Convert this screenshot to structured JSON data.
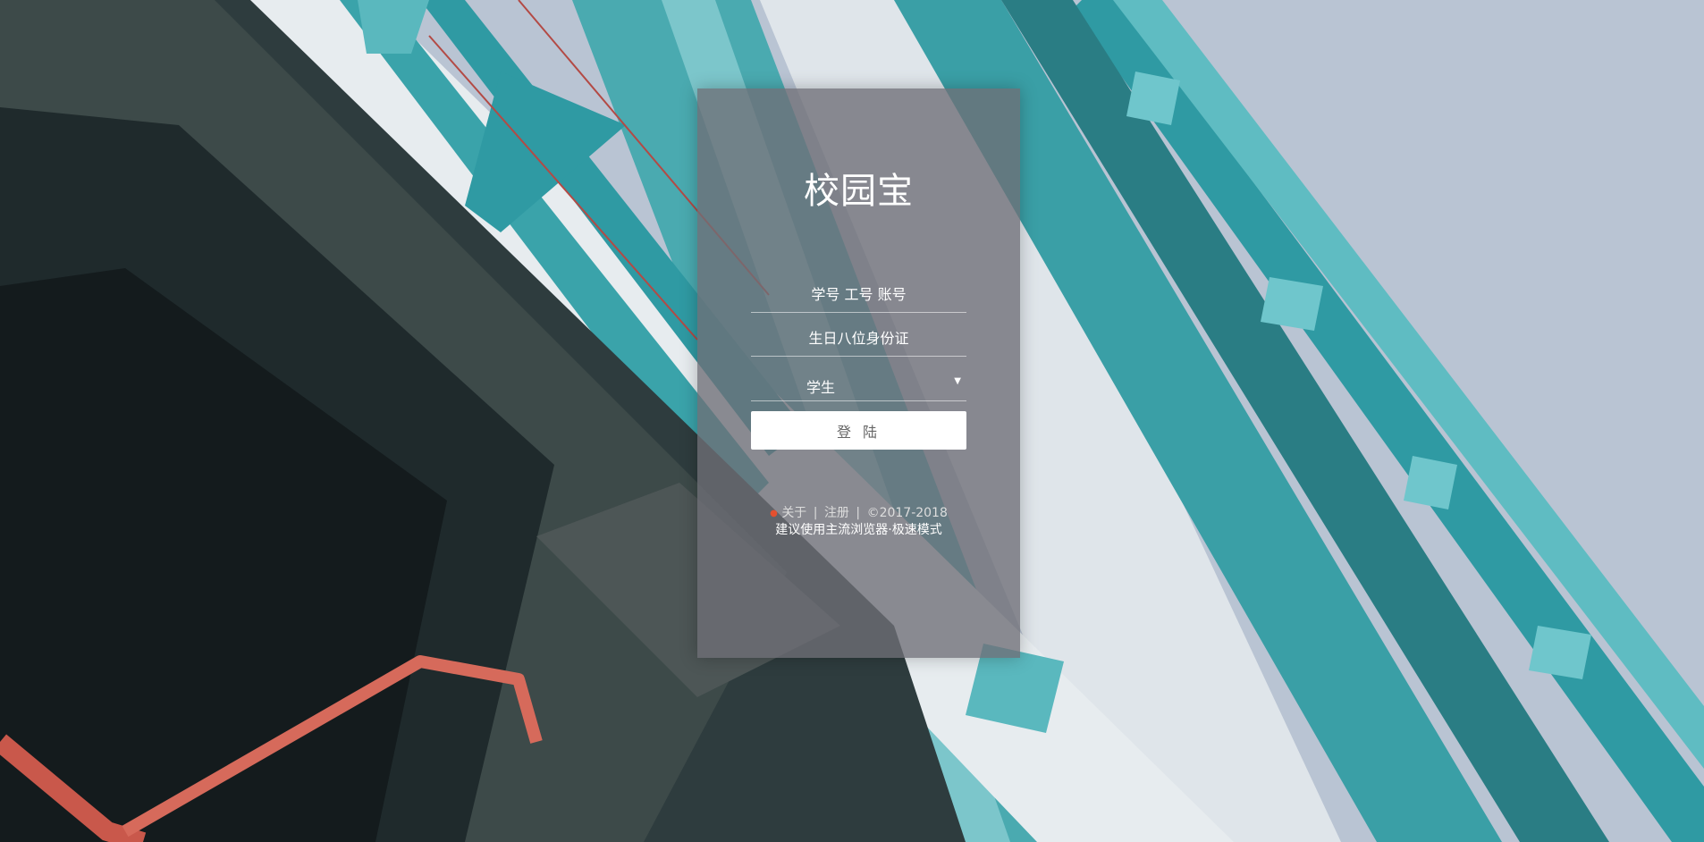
{
  "login": {
    "title": "校园宝",
    "username_placeholder": "学号 工号 账号",
    "password_placeholder": "生日八位身份证",
    "role_selected": "学生",
    "submit_label": "登 陆"
  },
  "footer": {
    "about": "关于",
    "register": "注册",
    "copyright": "©2017-2018",
    "separator": "|",
    "browser_note": "建议使用主流浏览器·极速模式"
  },
  "colors": {
    "accent_dot": "#e4502f",
    "teal_steel": "#2f9aa3",
    "sky": "#b9c4d3"
  }
}
